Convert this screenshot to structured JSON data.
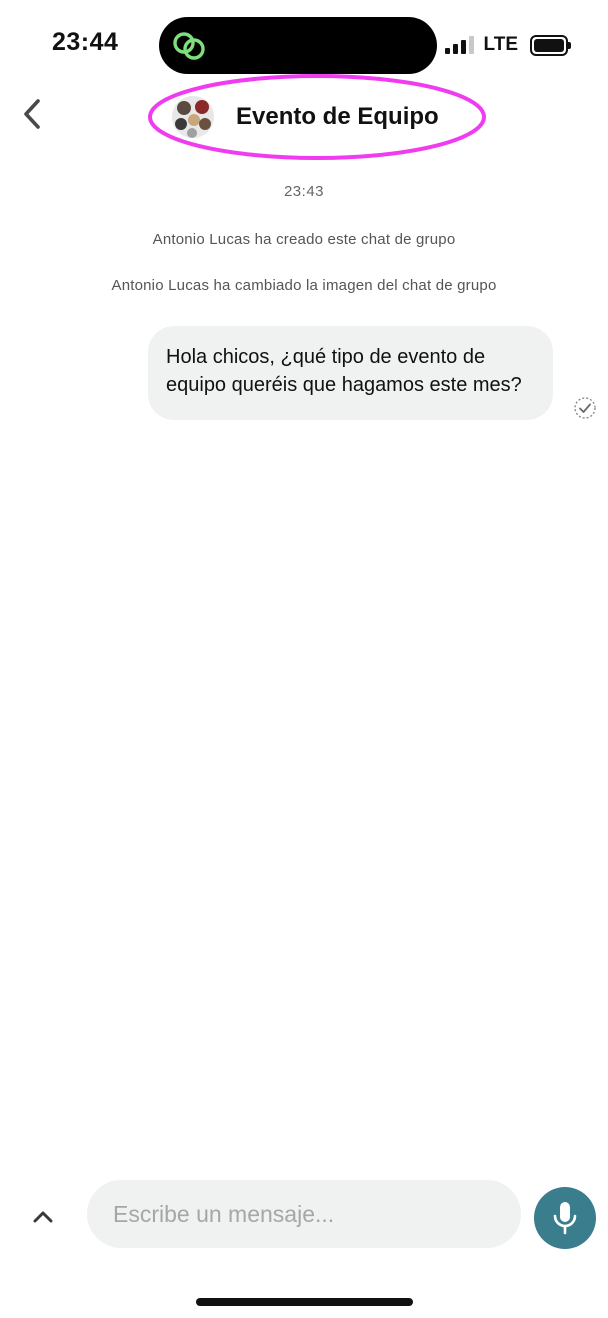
{
  "status_bar": {
    "time": "23:44",
    "network": "LTE"
  },
  "header": {
    "title": "Evento de Equipo",
    "highlight_color": "#f03cf0"
  },
  "conversation": {
    "timestamp": "23:43",
    "system_messages": [
      "Antonio Lucas ha creado este chat de grupo",
      "Antonio Lucas ha cambiado la imagen del chat de grupo"
    ],
    "messages": [
      {
        "line1": "Hola chicos, ¿qué tipo de evento de",
        "line2": "equipo queréis que hagamos este mes?"
      }
    ]
  },
  "composer": {
    "placeholder": "Escribe un mensaje..."
  },
  "colors": {
    "accent": "#3a7d8c",
    "bubble": "#f0f1f1",
    "island_icon": "#7de07a"
  }
}
